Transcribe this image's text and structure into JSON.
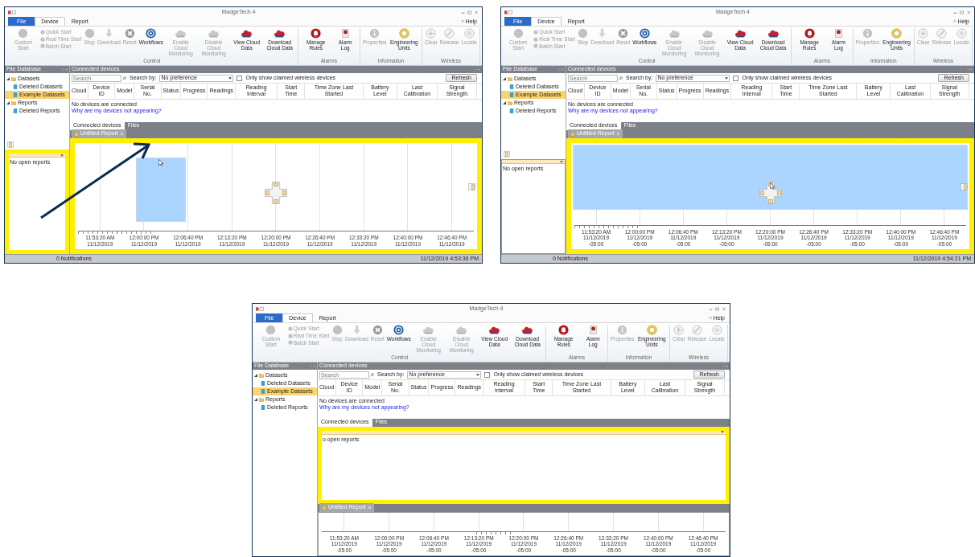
{
  "screens": [
    {
      "kind": "floating-drag",
      "window": {
        "title": "MadgeTech 4"
      },
      "menu_tabs": [
        {
          "label": "File",
          "kind": "file",
          "selected": false
        },
        {
          "label": "Device",
          "kind": "tab",
          "selected": true
        },
        {
          "label": "Report",
          "kind": "tab",
          "selected": false
        }
      ],
      "help": "Help",
      "ribbon": {
        "groups": [
          {
            "label": "Control",
            "items": [
              {
                "kind": "large",
                "label": "Custom Start",
                "disabled": true
              },
              {
                "kind": "stack",
                "buttons": [
                  {
                    "label": "Quick Start",
                    "disabled": true
                  },
                  {
                    "label": "Real Time Start",
                    "disabled": true
                  },
                  {
                    "label": "Batch Start",
                    "disabled": true
                  }
                ]
              },
              {
                "kind": "large",
                "label": "Stop",
                "disabled": true
              },
              {
                "kind": "large",
                "label": "Download",
                "disabled": true
              },
              {
                "kind": "large",
                "label": "Reset",
                "disabled": true
              },
              {
                "kind": "large",
                "label": "Workflows",
                "disabled": false
              },
              {
                "kind": "large",
                "label": "Enable Cloud Monitoring",
                "disabled": true
              },
              {
                "kind": "large",
                "label": "Disable Cloud Monitoring",
                "disabled": true
              },
              {
                "kind": "large",
                "label": "View Cloud Data",
                "disabled": false
              },
              {
                "kind": "large",
                "label": "Download Cloud Data",
                "disabled": false
              }
            ]
          },
          {
            "label": "Alarms",
            "items": [
              {
                "kind": "large",
                "label": "Manage Rules",
                "disabled": false
              },
              {
                "kind": "large",
                "label": "Alarm Log",
                "disabled": false
              }
            ]
          },
          {
            "label": "Information",
            "items": [
              {
                "kind": "large",
                "label": "Properties",
                "disabled": true
              },
              {
                "kind": "large",
                "label": "Engineering Units",
                "disabled": false
              }
            ]
          },
          {
            "label": "Wireless",
            "items": [
              {
                "kind": "large",
                "label": "Clear",
                "disabled": true
              },
              {
                "kind": "large",
                "label": "Release",
                "disabled": true
              },
              {
                "kind": "large",
                "label": "Locate",
                "disabled": true
              }
            ]
          }
        ]
      },
      "sidebar": {
        "title": "File Database",
        "tree": [
          {
            "label": "Datasets",
            "expanded": true,
            "selected": false,
            "children": [
              {
                "label": "Deleted Datasets",
                "selected": false
              },
              {
                "label": "Example Datasets",
                "selected": true
              }
            ]
          },
          {
            "label": "Reports",
            "expanded": true,
            "selected": false,
            "children": [
              {
                "label": "Deleted Reports",
                "selected": false
              }
            ]
          }
        ]
      },
      "connected_devices": {
        "title": "Connected devices",
        "search_placeholder": "Search",
        "search_by_label": "Search by:",
        "search_by_value": "No preference",
        "claimed_only": {
          "label": "Only show claimed wireless devices",
          "checked": false
        },
        "refresh": "Refresh",
        "columns": [
          "Cloud",
          "Device ID",
          "Model",
          "Serial No.",
          "Status",
          "Progress",
          "Readings",
          "Reading Interval",
          "Start Time",
          "Time Zone Last Started",
          "Battery Level",
          "Last Calibration",
          "Signal Strength"
        ],
        "message": "No devices are connected",
        "link": "Why are my devices not appearing?",
        "tabs": [
          {
            "label": "Connected devices",
            "selected": true
          },
          {
            "label": "Files",
            "selected": false
          }
        ]
      },
      "reports_panel": {
        "text": "No open reports"
      },
      "report": {
        "tab": "Untitled Report",
        "time_labels": [
          {
            "time": "11:53:20 AM",
            "date": "11/12/2019"
          },
          {
            "time": "12:00:00 PM",
            "date": "11/12/2019"
          },
          {
            "time": "12:06:40 PM",
            "date": "11/12/2019"
          },
          {
            "time": "12:13:20 PM",
            "date": "11/12/2019"
          },
          {
            "time": "12:20:00 PM",
            "date": "11/12/2019"
          },
          {
            "time": "12:26:40 PM",
            "date": "11/12/2019"
          },
          {
            "time": "12:33:20 PM",
            "date": "11/12/2019"
          },
          {
            "time": "12:40:00 PM",
            "date": "11/12/2019"
          },
          {
            "time": "12:46:40 PM",
            "date": "11/12/2019"
          }
        ]
      },
      "status_bar": {
        "notifications": "0 Notifications",
        "datetime": "11/12/2019 4:53:36 PM"
      }
    },
    {
      "kind": "dock-top-preview",
      "window": {
        "title": "MadgeTech 4"
      },
      "menu_tabs": [
        {
          "label": "File",
          "kind": "file",
          "selected": false
        },
        {
          "label": "Device",
          "kind": "tab",
          "selected": true
        },
        {
          "label": "Report",
          "kind": "tab",
          "selected": false
        }
      ],
      "help": "Help",
      "ribbon": {
        "groups": [
          {
            "label": "Control",
            "items": [
              {
                "kind": "large",
                "label": "Custom Start",
                "disabled": true
              },
              {
                "kind": "stack",
                "buttons": [
                  {
                    "label": "Quick Start",
                    "disabled": true
                  },
                  {
                    "label": "Real Time Start",
                    "disabled": true
                  },
                  {
                    "label": "Batch Start",
                    "disabled": true
                  }
                ]
              },
              {
                "kind": "large",
                "label": "Stop",
                "disabled": true
              },
              {
                "kind": "large",
                "label": "Download",
                "disabled": true
              },
              {
                "kind": "large",
                "label": "Reset",
                "disabled": true
              },
              {
                "kind": "large",
                "label": "Workflows",
                "disabled": false
              },
              {
                "kind": "large",
                "label": "Enable Cloud Monitoring",
                "disabled": true
              },
              {
                "kind": "large",
                "label": "Disable Cloud Monitoring",
                "disabled": true
              },
              {
                "kind": "large",
                "label": "View Cloud Data",
                "disabled": false
              },
              {
                "kind": "large",
                "label": "Download Cloud Data",
                "disabled": false
              }
            ]
          },
          {
            "label": "Alarms",
            "items": [
              {
                "kind": "large",
                "label": "Manage Rules",
                "disabled": false
              },
              {
                "kind": "large",
                "label": "Alarm Log",
                "disabled": false
              }
            ]
          },
          {
            "label": "Information",
            "items": [
              {
                "kind": "large",
                "label": "Properties",
                "disabled": true
              },
              {
                "kind": "large",
                "label": "Engineering Units",
                "disabled": false
              }
            ]
          },
          {
            "label": "Wireless",
            "items": [
              {
                "kind": "large",
                "label": "Clear",
                "disabled": true
              },
              {
                "kind": "large",
                "label": "Release",
                "disabled": true
              },
              {
                "kind": "large",
                "label": "Locate",
                "disabled": true
              }
            ]
          }
        ]
      },
      "sidebar": {
        "title": "File Database",
        "tree": [
          {
            "label": "Datasets",
            "expanded": true,
            "selected": false,
            "children": [
              {
                "label": "Deleted Datasets",
                "selected": false
              },
              {
                "label": "Example Datasets",
                "selected": true
              }
            ]
          },
          {
            "label": "Reports",
            "expanded": true,
            "selected": false,
            "children": [
              {
                "label": "Deleted Reports",
                "selected": false
              }
            ]
          }
        ]
      },
      "connected_devices": {
        "title": "Connected devices",
        "search_placeholder": "Search",
        "search_by_label": "Search by:",
        "search_by_value": "No preference",
        "claimed_only": {
          "label": "Only show claimed wireless devices",
          "checked": false
        },
        "refresh": "Refresh",
        "columns": [
          "Cloud",
          "Device ID",
          "Model",
          "Serial No.",
          "Status",
          "Progress",
          "Readings",
          "Reading Interval",
          "Start Time",
          "Time Zone Last Started",
          "Battery Level",
          "Last Calibration",
          "Signal Strength"
        ],
        "message": "No devices are connected",
        "link": "Why are my devices not appearing?",
        "tabs": [
          {
            "label": "Connected devices",
            "selected": true
          },
          {
            "label": "Files",
            "selected": false
          }
        ]
      },
      "reports_panel": {
        "text": "No open reports"
      },
      "report": {
        "tab": "Untitled Report",
        "time_labels": [
          {
            "time": "11:53:20 AM",
            "date": "11/12/2019",
            "zone": "-05:00"
          },
          {
            "time": "12:00:00 PM",
            "date": "11/12/2019",
            "zone": "-05:00"
          },
          {
            "time": "12:06:40 PM",
            "date": "11/12/2019",
            "zone": "-05:00"
          },
          {
            "time": "12:13:20 PM",
            "date": "11/12/2019",
            "zone": "-05:00"
          },
          {
            "time": "12:20:00 PM",
            "date": "11/12/2019",
            "zone": "-05:00"
          },
          {
            "time": "12:26:40 PM",
            "date": "11/12/2019",
            "zone": "-05:00"
          },
          {
            "time": "12:33:20 PM",
            "date": "11/12/2019",
            "zone": "-05:00"
          },
          {
            "time": "12:40:00 PM",
            "date": "11/12/2019",
            "zone": "-05:00"
          },
          {
            "time": "12:46:40 PM",
            "date": "11/12/2019",
            "zone": "-05:00"
          }
        ]
      },
      "status_bar": {
        "notifications": "0 Notifications",
        "datetime": "11/12/2019 4:54:21 PM"
      }
    },
    {
      "kind": "docked-top",
      "window": {
        "title": "MadgeTech 4"
      },
      "menu_tabs": [
        {
          "label": "File",
          "kind": "file",
          "selected": false
        },
        {
          "label": "Device",
          "kind": "tab",
          "selected": true
        },
        {
          "label": "Report",
          "kind": "tab",
          "selected": false
        }
      ],
      "help": "Help",
      "ribbon": {
        "groups": [
          {
            "label": "Control",
            "items": [
              {
                "kind": "large",
                "label": "Custom Start",
                "disabled": true
              },
              {
                "kind": "stack",
                "buttons": [
                  {
                    "label": "Quick Start",
                    "disabled": true
                  },
                  {
                    "label": "Real Time Start",
                    "disabled": true
                  },
                  {
                    "label": "Batch Start",
                    "disabled": true
                  }
                ]
              },
              {
                "kind": "large",
                "label": "Stop",
                "disabled": true
              },
              {
                "kind": "large",
                "label": "Download",
                "disabled": true
              },
              {
                "kind": "large",
                "label": "Reset",
                "disabled": true
              },
              {
                "kind": "large",
                "label": "Workflows",
                "disabled": false
              },
              {
                "kind": "large",
                "label": "Enable Cloud Monitoring",
                "disabled": true
              },
              {
                "kind": "large",
                "label": "Disable Cloud Monitoring",
                "disabled": true
              },
              {
                "kind": "large",
                "label": "View Cloud Data",
                "disabled": false
              },
              {
                "kind": "large",
                "label": "Download Cloud Data",
                "disabled": false
              }
            ]
          },
          {
            "label": "Alarms",
            "items": [
              {
                "kind": "large",
                "label": "Manage Rules",
                "disabled": false
              },
              {
                "kind": "large",
                "label": "Alarm Log",
                "disabled": false
              }
            ]
          },
          {
            "label": "Information",
            "items": [
              {
                "kind": "large",
                "label": "Properties",
                "disabled": true
              },
              {
                "kind": "large",
                "label": "Engineering Units",
                "disabled": false
              }
            ]
          },
          {
            "label": "Wireless",
            "items": [
              {
                "kind": "large",
                "label": "Clear",
                "disabled": true
              },
              {
                "kind": "large",
                "label": "Release",
                "disabled": true
              },
              {
                "kind": "large",
                "label": "Locate",
                "disabled": true
              }
            ]
          }
        ]
      },
      "sidebar": {
        "title": "File Database",
        "tree": [
          {
            "label": "Datasets",
            "expanded": true,
            "selected": false,
            "children": [
              {
                "label": "Deleted Datasets",
                "selected": false
              },
              {
                "label": "Example Datasets",
                "selected": true
              }
            ]
          },
          {
            "label": "Reports",
            "expanded": true,
            "selected": false,
            "children": [
              {
                "label": "Deleted Reports",
                "selected": false
              }
            ]
          }
        ]
      },
      "connected_devices": {
        "title": "Connected devices",
        "search_placeholder": "Search",
        "search_by_label": "Search by:",
        "search_by_value": "No preference",
        "claimed_only": {
          "label": "Only show claimed wireless devices",
          "checked": false
        },
        "refresh": "Refresh",
        "columns": [
          "Cloud",
          "Device ID",
          "Model",
          "Serial No.",
          "Status",
          "Progress",
          "Readings",
          "Reading Interval",
          "Start Time",
          "Time Zone Last Started",
          "Battery Level",
          "Last Calibration",
          "Signal Strength"
        ],
        "message": "No devices are connected",
        "link": "Why are my devices not appearing?",
        "tabs": [
          {
            "label": "Connected devices",
            "selected": true
          },
          {
            "label": "Files",
            "selected": false
          }
        ]
      },
      "reports_panel": {
        "text": "o open reports"
      },
      "report": {
        "tab": "Untitled Report",
        "time_labels": [
          {
            "time": "11:53:20 AM",
            "date": "11/12/2019",
            "zone": "-05:00"
          },
          {
            "time": "12:00:00 PM",
            "date": "11/12/2019",
            "zone": "-05:00"
          },
          {
            "time": "12:06:40 PM",
            "date": "11/12/2019",
            "zone": "-05:00"
          },
          {
            "time": "12:13:20 PM",
            "date": "11/12/2019",
            "zone": "-05:00"
          },
          {
            "time": "12:20:00 PM",
            "date": "11/12/2019",
            "zone": "-05:00"
          },
          {
            "time": "12:26:40 PM",
            "date": "11/12/2019",
            "zone": "-05:00"
          },
          {
            "time": "12:33:20 PM",
            "date": "11/12/2019",
            "zone": "-05:00"
          },
          {
            "time": "12:40:00 PM",
            "date": "11/12/2019",
            "zone": "-05:00"
          },
          {
            "time": "12:46:40 PM",
            "date": "11/12/2019",
            "zone": "-05:00"
          }
        ]
      }
    }
  ]
}
